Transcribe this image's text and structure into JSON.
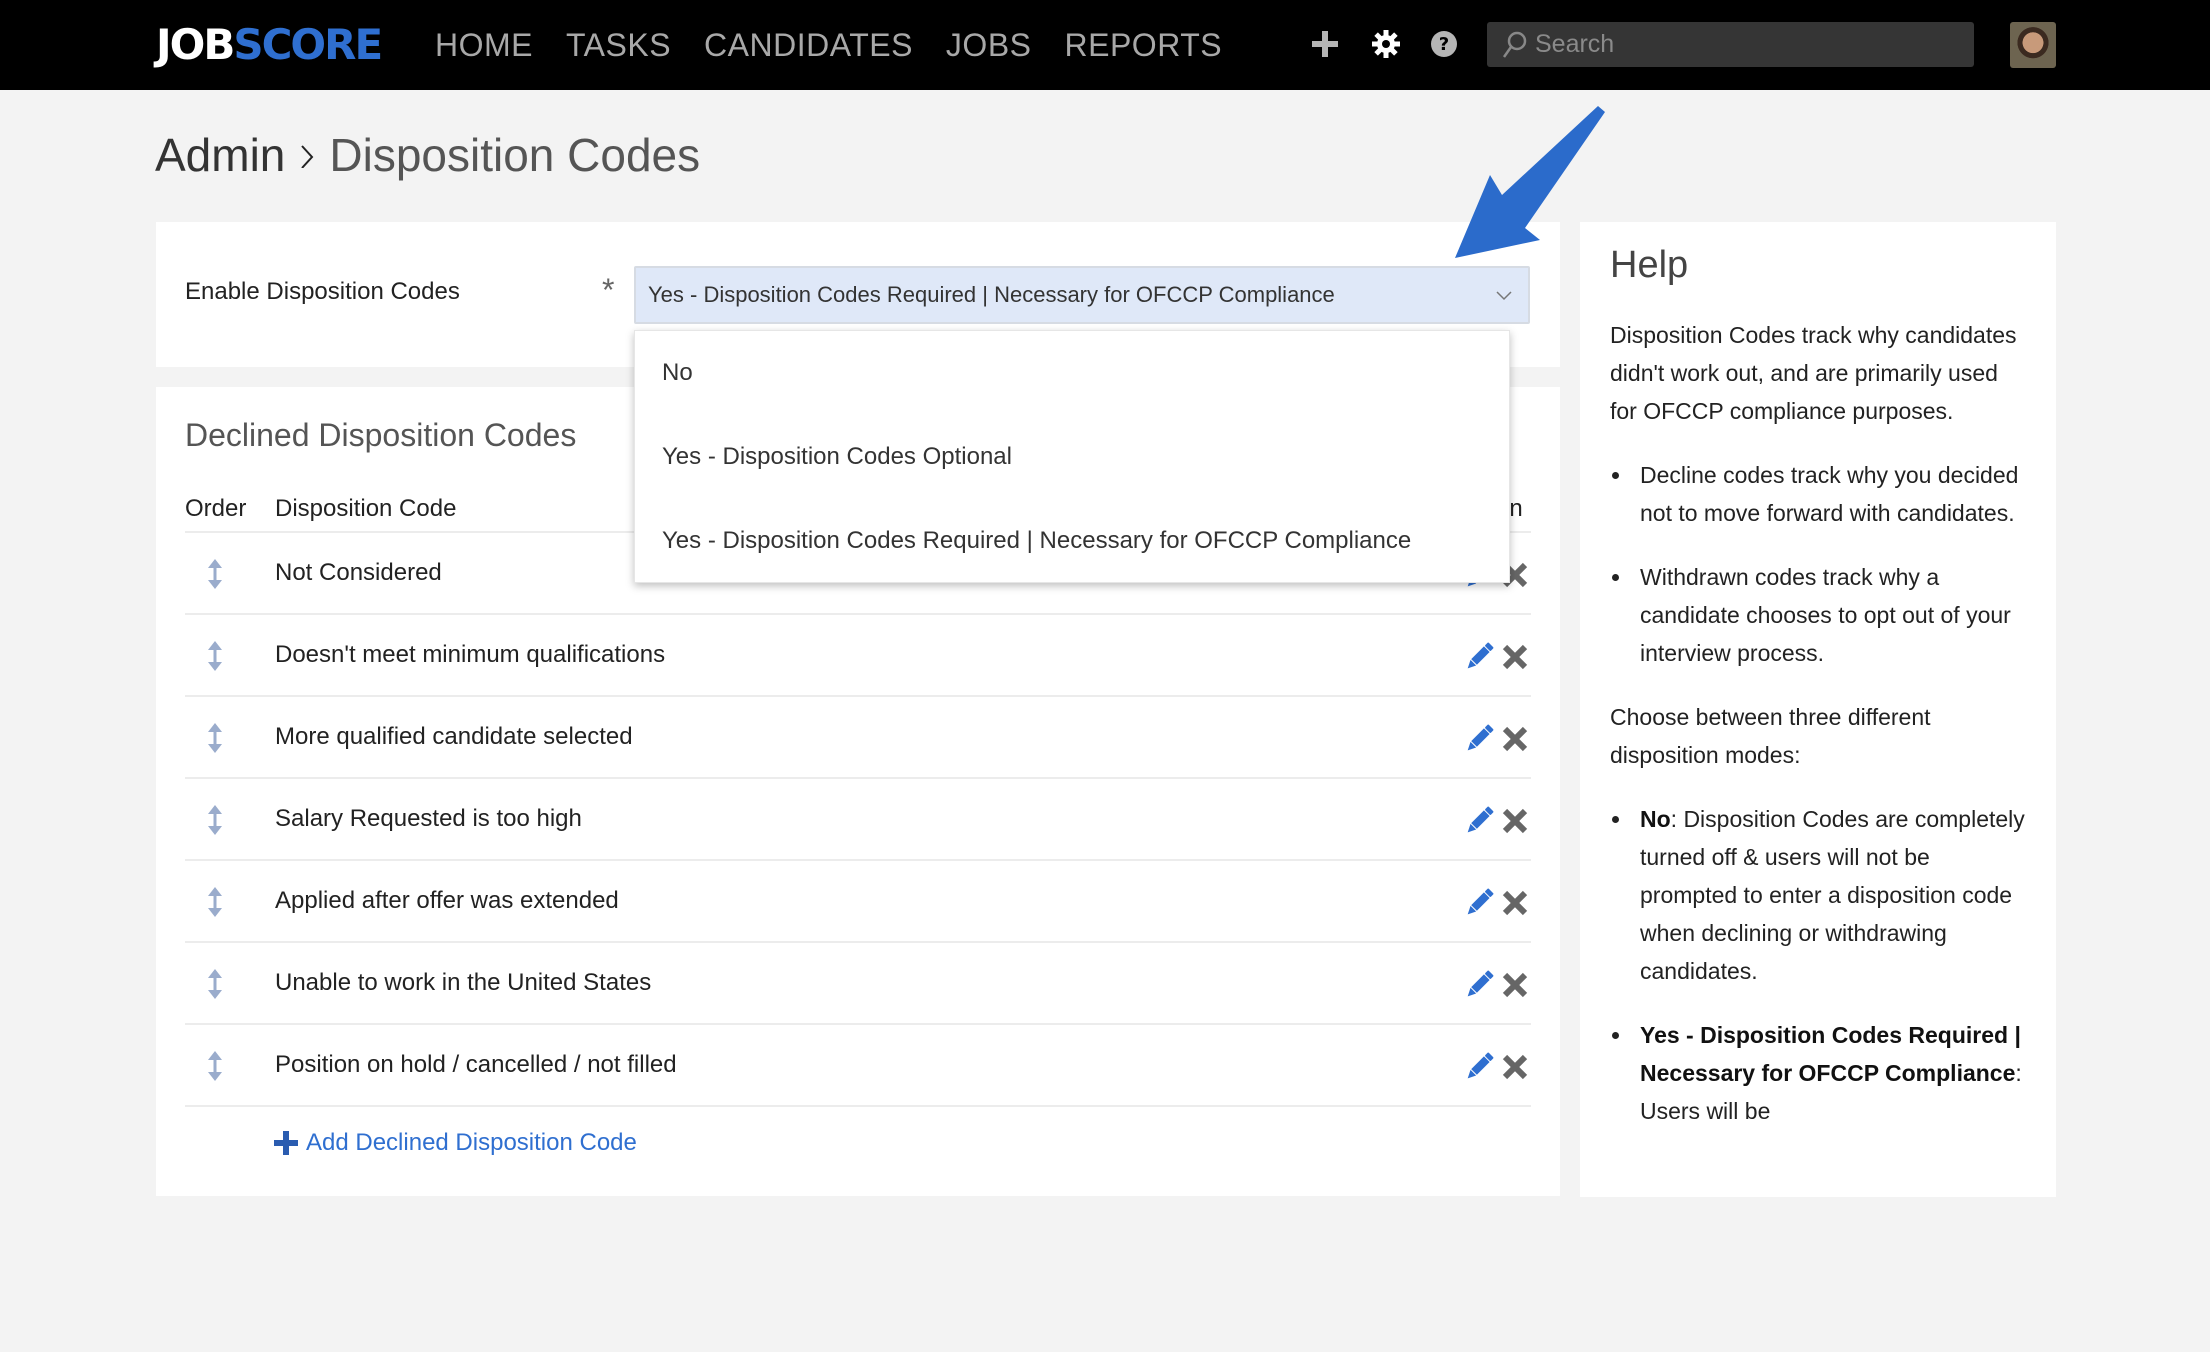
{
  "header": {
    "logo_part1": "JOB",
    "logo_part2": "SCORE",
    "nav": [
      "HOME",
      "TASKS",
      "CANDIDATES",
      "JOBS",
      "REPORTS"
    ],
    "icons": [
      "plus-icon",
      "gear-icon",
      "help-icon"
    ],
    "search_placeholder": "Search"
  },
  "breadcrumb": {
    "parent": "Admin",
    "current": "Disposition Codes"
  },
  "enable": {
    "label": "Enable Disposition Codes",
    "required_mark": "*",
    "selected": "Yes - Disposition Codes Required | Necessary for OFCCP Compliance",
    "options": [
      "No",
      "Yes - Disposition Codes Optional",
      "Yes - Disposition Codes Required | Necessary for OFCCP Compliance"
    ]
  },
  "declined": {
    "title": "Declined Disposition Codes",
    "columns": {
      "order": "Order",
      "code": "Disposition Code",
      "action": "Action"
    },
    "rows": [
      "Not Considered",
      "Doesn't meet minimum qualifications",
      "More qualified candidate selected",
      "Salary Requested is too high",
      "Applied after offer was extended",
      "Unable to work in the United States",
      "Position on hold / cancelled / not filled"
    ],
    "add_label": "Add Declined Disposition Code"
  },
  "help": {
    "title": "Help",
    "intro": "Disposition Codes track why candidates didn't work out, and are primarily used for OFCCP compliance purposes.",
    "bullets1": [
      "Decline codes track why you decided not to move forward with candidates.",
      "Withdrawn codes track why a candidate chooses to opt out of your interview process."
    ],
    "modes_intro": "Choose between three different disposition modes:",
    "modes": [
      {
        "bold": "No",
        "text": ": Disposition Codes are completely turned off & users will not be prompted to enter a disposition code when declining or withdrawing candidates."
      },
      {
        "bold": "Yes - Disposition Codes Required | Necessary for OFCCP Compliance",
        "text": ": Users will be"
      }
    ]
  },
  "colors": {
    "brand_blue": "#2f6fd0",
    "header_bg": "#000000",
    "select_bg": "#dfe8f8",
    "delete_gray": "#666666",
    "drag_icon": "#9aaccc"
  }
}
